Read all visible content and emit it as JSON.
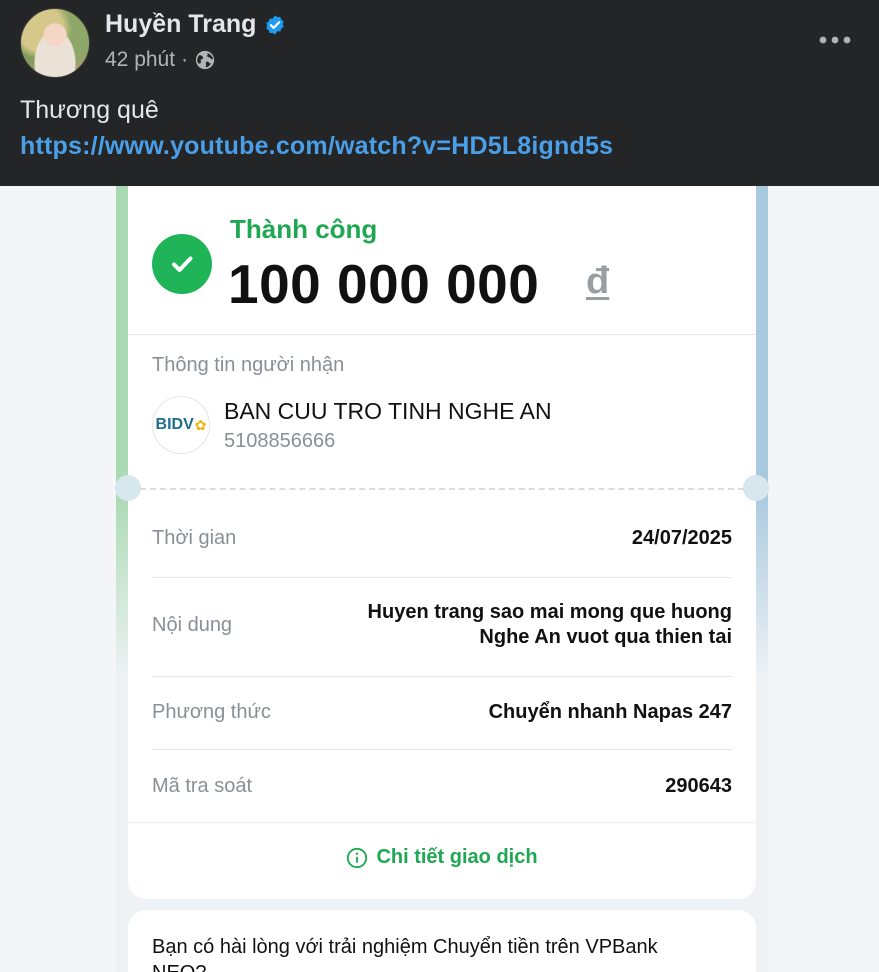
{
  "post": {
    "author": "Huyền Trang",
    "time": "42 phút",
    "separator": "·",
    "text": "Thương quê",
    "link": "https://www.youtube.com/watch?v=HD5L8ignd5s"
  },
  "icons": {
    "verified": "verified-badge-icon",
    "privacy": "globe-icon",
    "more": "more-options-icon",
    "status": "checkmark-icon",
    "info": "info-icon"
  },
  "colors": {
    "facebook_bg": "#242526",
    "link": "#4a9fe8",
    "success_green": "#1fb457",
    "verified_blue": "#1d9bf0"
  },
  "receipt": {
    "status": "Thành công",
    "amount": "100 000 000",
    "currency": "đ",
    "recipient_section_label": "Thông tin người nhận",
    "bank_logo_text": "BIDV",
    "recipient_name": "BAN CUU TRO TINH NGHE AN",
    "recipient_account": "5108856666",
    "details": [
      {
        "label": "Thời gian",
        "value": "24/07/2025"
      },
      {
        "label": "Nội dung",
        "value_line1": "Huyen trang sao mai mong que huong",
        "value_line2": "Nghe An vuot qua thien tai"
      },
      {
        "label": "Phương thức",
        "value": "Chuyển nhanh Napas 247"
      },
      {
        "label": "Mã tra soát",
        "value": "290643"
      }
    ],
    "details_link": "Chi tiết giao dịch"
  },
  "survey": {
    "text": "Bạn có hài lòng với trải nghiệm Chuyển tiền trên VPBank NEO?"
  }
}
